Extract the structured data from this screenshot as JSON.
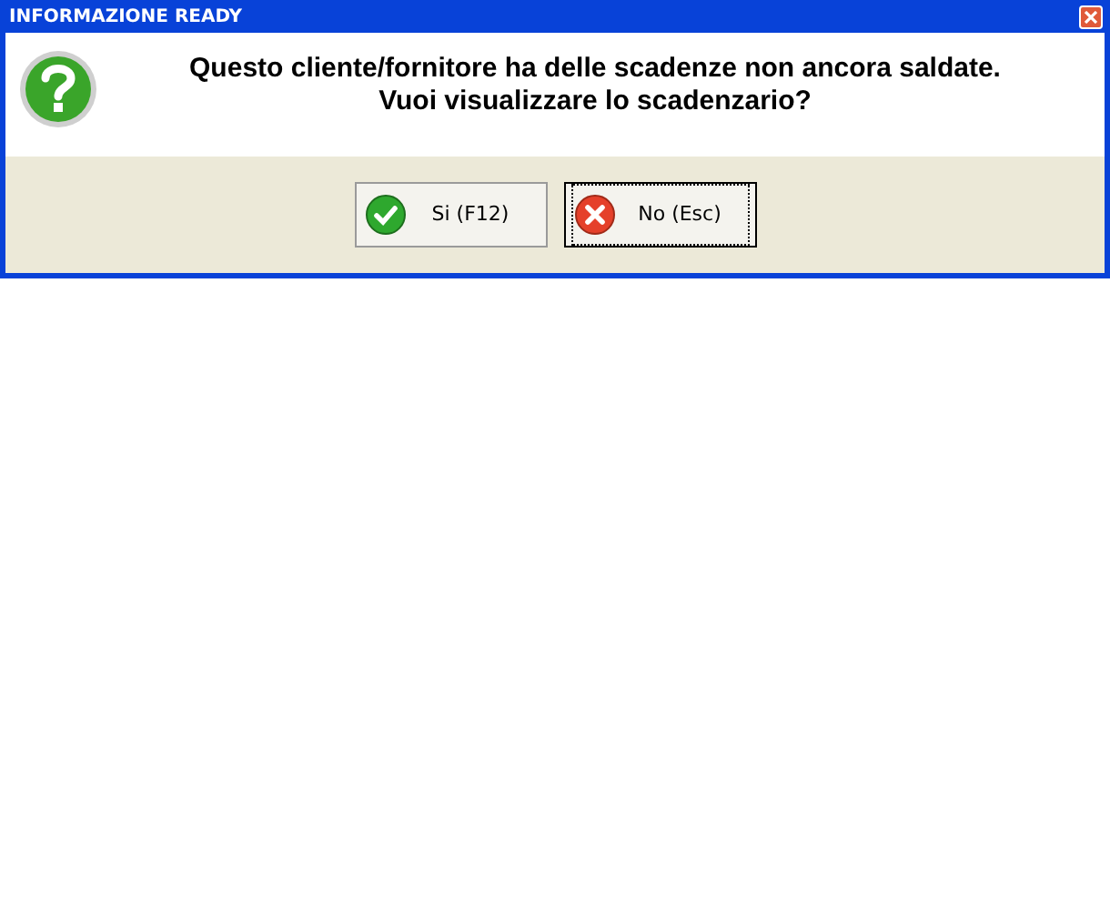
{
  "window": {
    "title": "INFORMAZIONE READY"
  },
  "message": "Questo cliente/fornitore ha delle scadenze non ancora saldate. Vuoi visualizzare lo scadenzario?",
  "buttons": [
    {
      "label": "Si (F12)",
      "kind": "yes",
      "focused": false
    },
    {
      "label": "No (Esc)",
      "kind": "no",
      "focused": true
    }
  ]
}
